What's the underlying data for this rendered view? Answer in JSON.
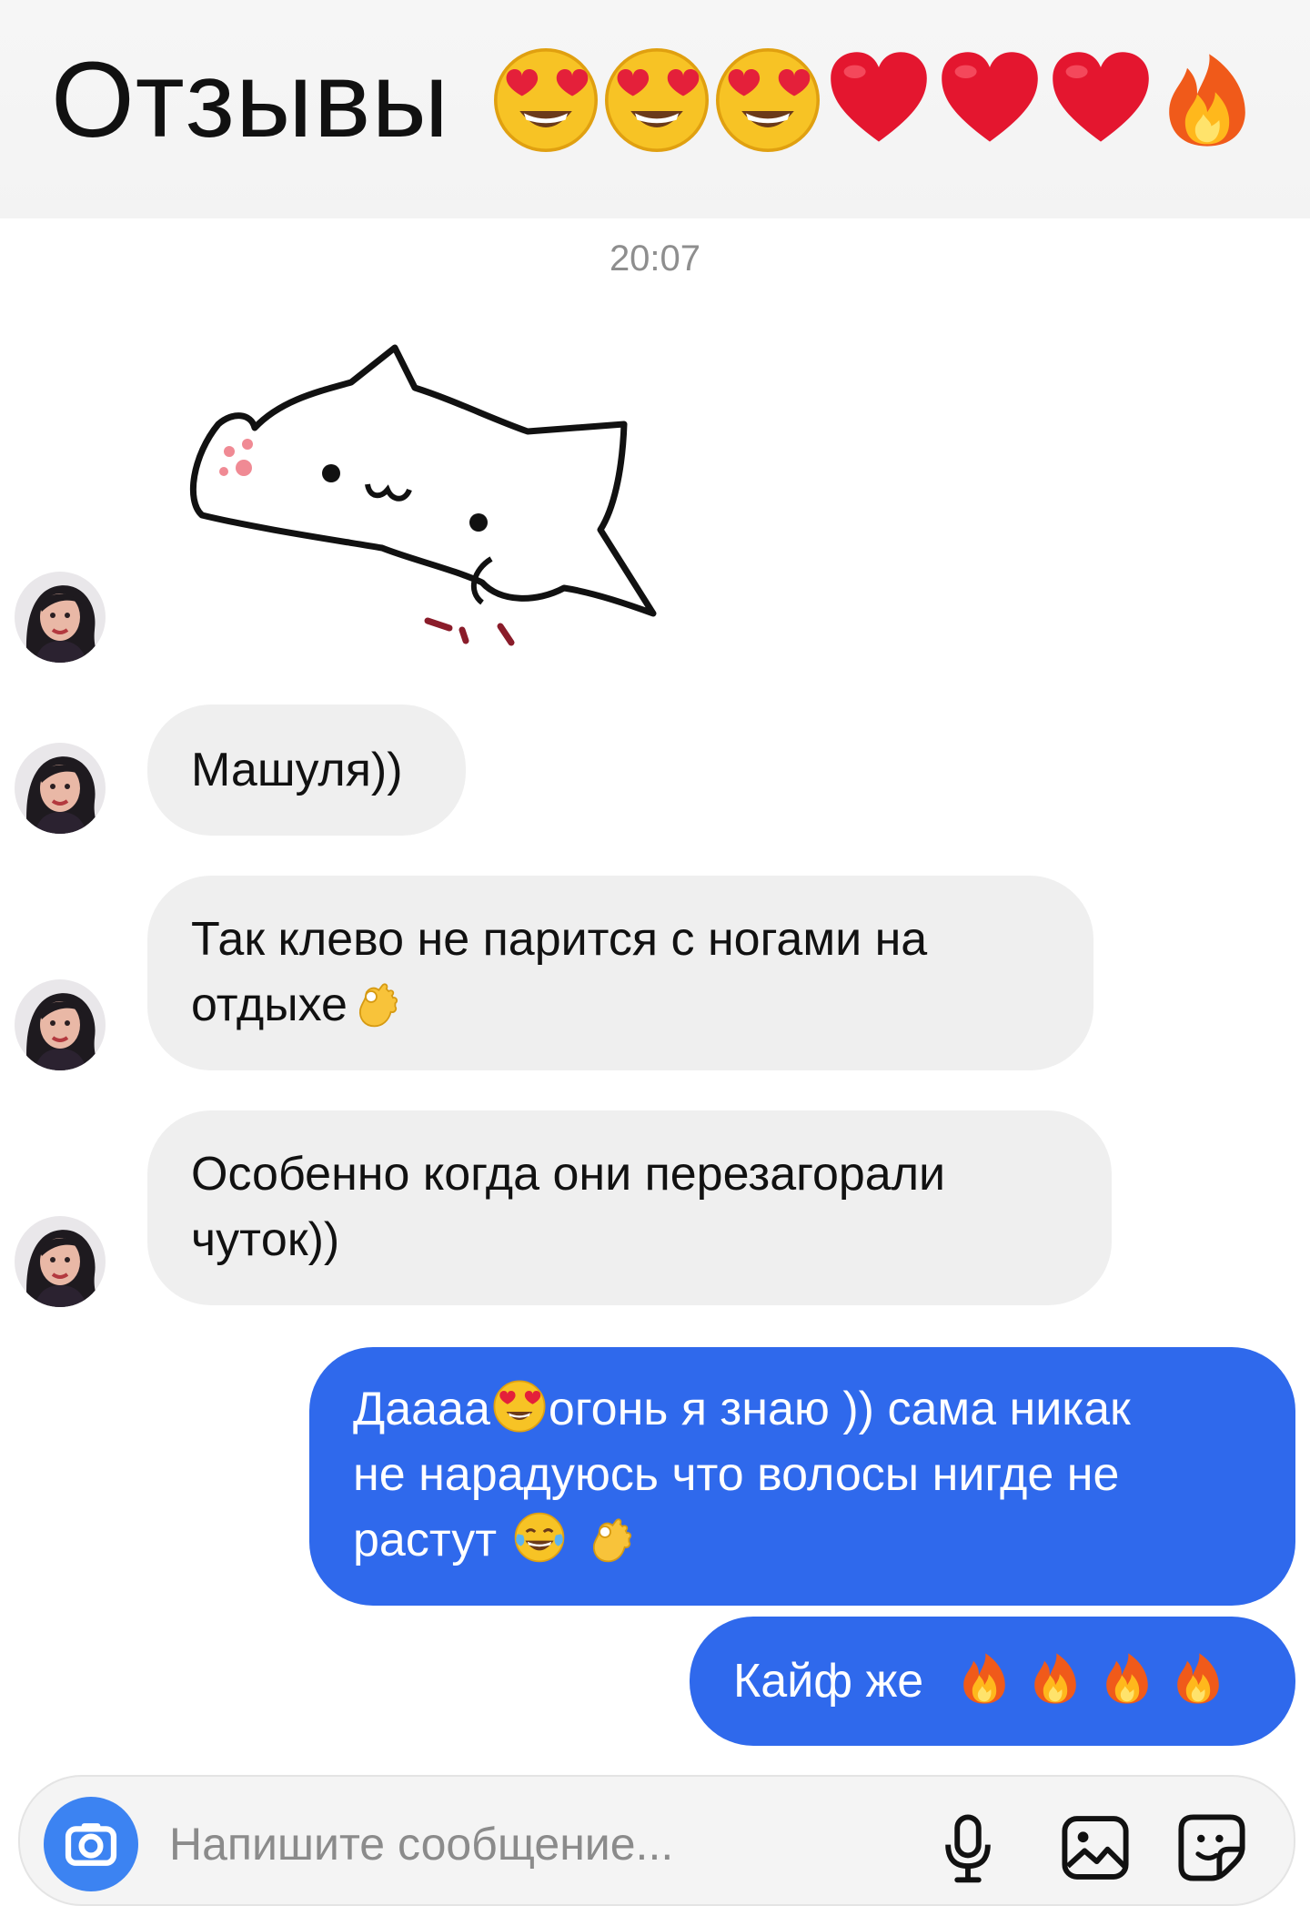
{
  "header": {
    "title": "Отзывы",
    "emojis": [
      "heart-eyes-emoji",
      "heart-eyes-emoji",
      "heart-eyes-emoji",
      "red-heart-emoji",
      "red-heart-emoji",
      "red-heart-emoji",
      "fire-emoji"
    ]
  },
  "conversation": {
    "timestamp": "20:07",
    "sticker": "cat-sticker",
    "incoming": [
      {
        "text": "Машуля))"
      },
      {
        "line1": "Так клево не парится  с ногами на",
        "line2": "отдыхе",
        "emoji": "ok-hand-emoji"
      },
      {
        "line1": "Особенно когда они перезагорали",
        "line2": "чутoк))"
      }
    ],
    "outgoing": [
      {
        "part1": "Даааа",
        "part2": "огонь я знаю )) сама никак",
        "line2": "не нарадуюсь что волосы нигде не",
        "line3": "растут",
        "emojis": [
          "heart-eyes-emoji",
          "tears-of-joy-emoji",
          "ok-hand-emoji"
        ]
      },
      {
        "text": "Кайф же",
        "emojis": [
          "fire-emoji",
          "fire-emoji",
          "fire-emoji",
          "fire-emoji"
        ]
      }
    ]
  },
  "composer": {
    "placeholder": "Напишите сообщение...",
    "icons": [
      "camera-icon",
      "microphone-icon",
      "image-icon",
      "sticker-icon"
    ]
  },
  "colors": {
    "outgoing_bubble": "#2f69ec",
    "incoming_bubble": "#efefef",
    "camera_button": "#3c83f2"
  }
}
